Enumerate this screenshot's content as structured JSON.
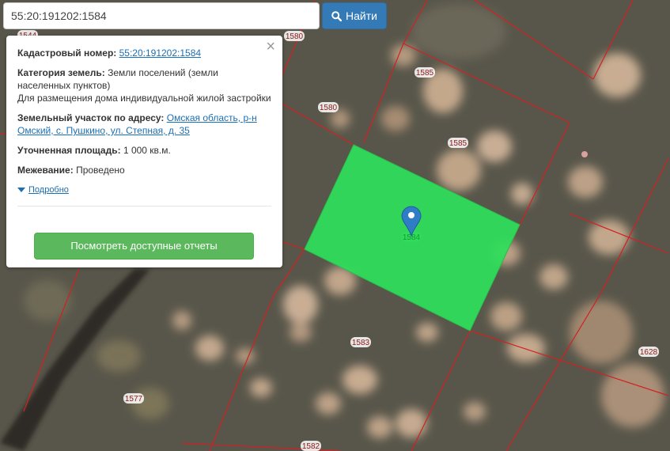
{
  "search": {
    "value": "55:20:191202:1584",
    "button_label": "Найти"
  },
  "popup": {
    "cadastral_label": "Кадастровый номер:",
    "cadastral_value": "55:20:191202:1584",
    "category_label": "Категория земель:",
    "category_value": "Земли поселений (земли населенных пунктов)",
    "category_purpose": "Для размещения дома индивидуальной жилой застройки",
    "address_label": "Земельный участок по адресу:",
    "address_value": "Омская область, р-н Омский, с. Пушкино, ул. Степная, д. 35",
    "area_label": "Уточненная площадь:",
    "area_value": "1 000 кв.м.",
    "survey_label": "Межевание:",
    "survey_value": "Проведено",
    "more_label": "Подробно",
    "report_button": "Посмотреть доступные отчеты",
    "close_glyph": "×"
  },
  "map": {
    "parcel_labels": [
      "1544",
      "1580",
      "1585",
      "1580",
      "1585",
      "1584",
      "1583",
      "1577",
      "1582",
      "1628"
    ],
    "colors": {
      "selected_parcel": "#2ee05a",
      "boundary": "#d42020",
      "marker": "#2f7dc4"
    }
  }
}
